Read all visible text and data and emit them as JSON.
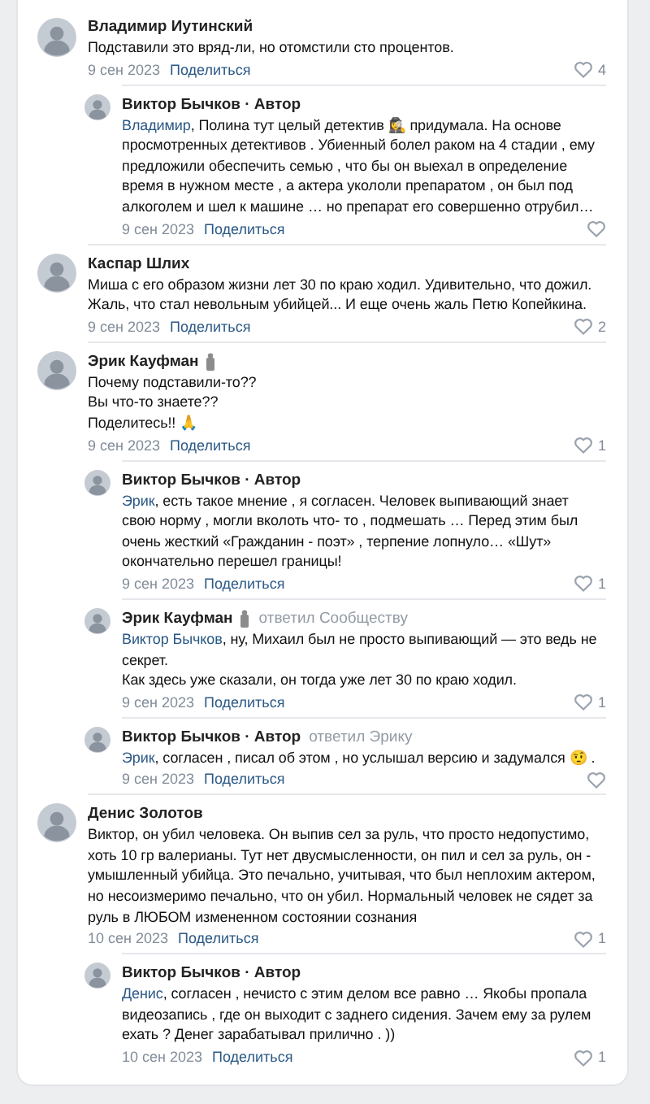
{
  "comments": [
    {
      "author": "Владимир Иутинский",
      "text": "Подставили это вряд-ли, но отомстили сто процентов.",
      "date": "9 сен 2023",
      "share": "Поделиться",
      "likes": "4",
      "replies": [
        {
          "author": "Виктор Бычков · Автор",
          "mention": "Владимир",
          "text": ", Полина тут целый детектив 🕵️‍♀️ придумала. На основе просмотренных детективов . Убиенный болел раком на 4 стадии , ему предложили обеспечить семью , что бы он выехал в определение время в нужном месте , а актера укололи препаратом , он был под алкоголем и шел к машине … но препарат его совершенно отрубил…",
          "date": "9 сен 2023",
          "share": "Поделиться"
        }
      ]
    },
    {
      "author": "Каспар Шлих",
      "text": "Миша с его образом жизни лет 30 по краю ходил. Удивительно, что дожил. Жаль, что стал невольным убийцей... И еще очень жаль Петю Копейкина.",
      "date": "9 сен 2023",
      "share": "Поделиться",
      "likes": "2"
    },
    {
      "author": "Эрик Кауфман",
      "badge": true,
      "text": "Почему подставили-то??\nВы что-то знаете??\nПоделитесь!! 🙏",
      "date": "9 сен 2023",
      "share": "Поделиться",
      "likes": "1",
      "replies": [
        {
          "author": "Виктор Бычков · Автор",
          "mention": "Эрик",
          "text": ", есть такое мнение , я согласен. Человек выпивающий знает свою норму , могли вколоть что- то , подмешать … Перед этим был очень жесткий «Гражданин - поэт» , терпение лопнуло… «Шут» окончательно перешел границы!",
          "date": "9 сен 2023",
          "share": "Поделиться",
          "likes": "1"
        },
        {
          "author": "Эрик Кауфман",
          "badge": true,
          "replied_to": "ответил Сообществу",
          "mention": "Виктор Бычков",
          "text": ", ну, Михаил был не просто выпивающий — это ведь не секрет.\nКак здесь уже сказали, он тогда уже лет 30 по краю ходил.",
          "date": "9 сен 2023",
          "share": "Поделиться",
          "likes": "1"
        },
        {
          "author": "Виктор Бычков · Автор",
          "replied_to": "ответил Эрику",
          "mention": "Эрик",
          "text": ", согласен , писал об этом , но услышал версию и задумался 🤨 .",
          "date": "9 сен 2023",
          "share": "Поделиться"
        }
      ]
    },
    {
      "author": "Денис Золотов",
      "text": "Виктор, он убил человека. Он выпив сел за руль, что просто недопустимо, хоть 10 гр валерианы. Тут нет двусмысленности, он пил и сел за руль, он - умышленный убийца. Это печально, учитывая, что был неплохим актером, но несоизмеримо печально, что он убил. Нормальный человек не сядет за руль в ЛЮБОМ измененном состоянии сознания",
      "date": "10 сен 2023",
      "share": "Поделиться",
      "likes": "1",
      "replies": [
        {
          "author": "Виктор Бычков · Автор",
          "mention": "Денис",
          "text": ", согласен , нечисто с этим делом все равно … Якобы пропала видеозапись , где он выходит с заднего сидения. Зачем ему за рулем ехать ? Денег зарабатывал прилично . ))",
          "date": "10 сен 2023",
          "share": "Поделиться",
          "likes": "1"
        }
      ]
    }
  ]
}
